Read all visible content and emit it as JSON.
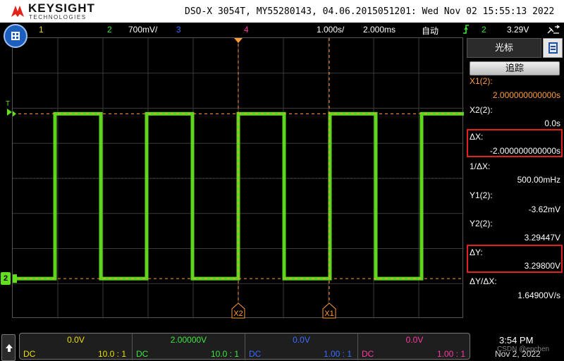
{
  "header": {
    "brand": "KEYSIGHT",
    "brand_sub": "TECHNOLOGIES",
    "title": "DSO-X 3054T, MY55280143, 04.06.2015051201: Wed Nov 02 15:55:13 2022"
  },
  "statusbar": {
    "ch1": "1",
    "ch2": "2",
    "ch2_scale": "700mV/",
    "ch3": "3",
    "ch4": "4",
    "timebase": "1.000s/",
    "delay": "2.000ms",
    "mode": "自动",
    "trigger_source": "2",
    "trigger_level": "3.29V",
    "colors": {
      "ch1": "#e8e000",
      "ch2": "#3ee63e",
      "ch3": "#3a6cff",
      "ch4": "#ff3aa0"
    }
  },
  "plot": {
    "cursor_x1_label": "X1",
    "cursor_x2_label": "X2",
    "trigger_marker": "T",
    "ground_marker": "2",
    "waveform_color": "#62e01e",
    "cursor_color": "#ff9d3a",
    "signal": {
      "high_level_v": 3.29,
      "low_level_v": 0.0,
      "period_s": 2.0,
      "edges_div": [
        0,
        1,
        2,
        3,
        4,
        5,
        6,
        7,
        8,
        9,
        10
      ]
    }
  },
  "side_panel": {
    "tab_label": "光标",
    "track_button": "追踪",
    "x1_label": "X1(2):",
    "x1_value": "2.000000000000s",
    "x2_label": "X2(2):",
    "x2_value": "0.0s",
    "dx_label": "ΔX:",
    "dx_value": "-2.000000000000s",
    "inv_dx_label": "1/ΔX:",
    "inv_dx_value": "500.00mHz",
    "y1_label": "Y1(2):",
    "y1_value": "-3.62mV",
    "y2_label": "Y2(2):",
    "y2_value": "3.29447V",
    "dy_label": "ΔY:",
    "dy_value": "3.29800V",
    "dydx_label": "ΔY/ΔX:",
    "dydx_value": "1.64900V/s"
  },
  "channels": [
    {
      "offset": "0.0V",
      "coupling": "DC",
      "ratio": "10.0 : 1",
      "color": "#e8e000"
    },
    {
      "offset": "2.00000V",
      "coupling": "DC",
      "ratio": "10.0 : 1",
      "color": "#3ee63e"
    },
    {
      "offset": "0.0V",
      "coupling": "DC",
      "ratio": "1.00 : 1",
      "color": "#3a6cff"
    },
    {
      "offset": "0.0V",
      "coupling": "DC",
      "ratio": "1.00 : 1",
      "color": "#ff3aa0"
    }
  ],
  "clock": {
    "time": "3:54 PM",
    "date": "Nov 2, 2022",
    "watermark": "CSDN @epchen"
  }
}
